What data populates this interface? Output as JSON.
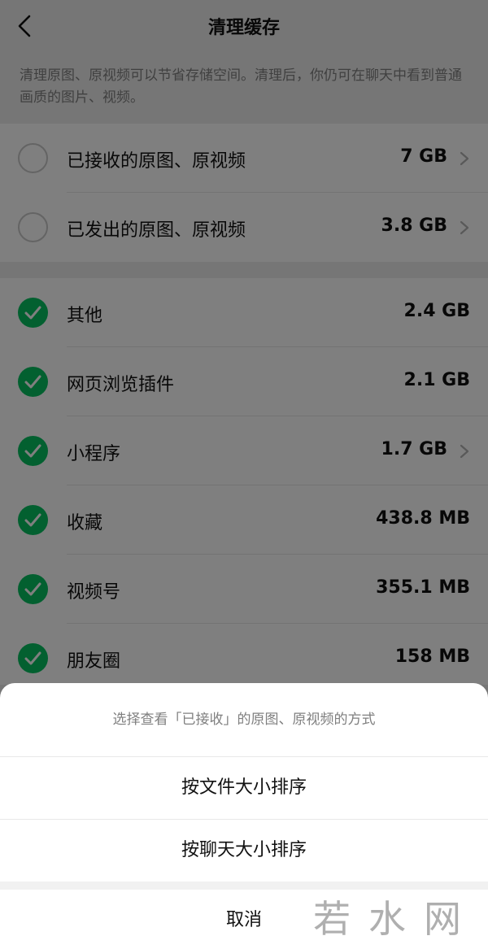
{
  "header": {
    "title": "清理缓存"
  },
  "description": "清理原图、原视频可以节省存储空间。清理后，你仍可在聊天中看到普通画质的图片、视频。",
  "group1": [
    {
      "label": "已接收的原图、原视频",
      "size": "7 GB",
      "checked": false,
      "arrow": true
    },
    {
      "label": "已发出的原图、原视频",
      "size": "3.8 GB",
      "checked": false,
      "arrow": true
    }
  ],
  "group2": [
    {
      "label": "其他",
      "size": "2.4 GB",
      "checked": true,
      "arrow": false
    },
    {
      "label": "网页浏览插件",
      "size": "2.1 GB",
      "checked": true,
      "arrow": false
    },
    {
      "label": "小程序",
      "size": "1.7 GB",
      "checked": true,
      "arrow": true
    },
    {
      "label": "收藏",
      "size": "438.8 MB",
      "checked": true,
      "arrow": false
    },
    {
      "label": "视频号",
      "size": "355.1 MB",
      "checked": true,
      "arrow": false
    },
    {
      "label": "朋友圈",
      "size": "158 MB",
      "checked": true,
      "arrow": false
    }
  ],
  "sheet": {
    "title": "选择查看「已接收」的原图、原视频的方式",
    "option_file": "按文件大小排序",
    "option_chat": "按聊天大小排序",
    "cancel": "取消"
  },
  "watermark": "若水网",
  "colors": {
    "accent": "#07c160",
    "background": "#ededed",
    "sheet": "#ffffff"
  },
  "icons": {
    "back": "chevron-left-icon",
    "check": "checkmark-icon",
    "arrow": "chevron-right-icon"
  }
}
